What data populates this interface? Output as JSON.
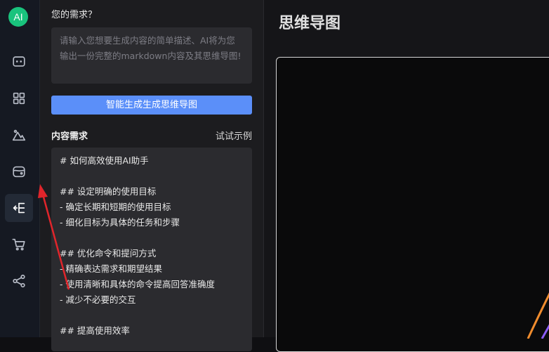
{
  "sidebar": {
    "logo_text": "AI",
    "items": [
      {
        "icon": "chat-icon"
      },
      {
        "icon": "apps-grid-icon"
      },
      {
        "icon": "image-landscape-icon"
      },
      {
        "icon": "wallet-icon"
      },
      {
        "icon": "mindmap-icon",
        "active": true
      },
      {
        "icon": "cart-icon"
      },
      {
        "icon": "share-icon"
      }
    ]
  },
  "panel": {
    "question_label": "您的需求？",
    "prompt_placeholder": "请输入您想要生成内容的简单描述、AI将为您输出一份完整的markdown内容及其思维导图!",
    "generate_button": "智能生成生成思维导图",
    "content_title": "内容需求",
    "example_link": "试试示例",
    "content_lines": [
      "# 如何高效使用AI助手",
      "",
      "## 设定明确的使用目标",
      "- 确定长期和短期的使用目标",
      "- 细化目标为具体的任务和步骤",
      "",
      "## 优化命令和提问方式",
      "- 精确表达需求和期望结果",
      "- 使用清晰和具体的命令提高回答准确度",
      "- 减少不必要的交互",
      "",
      "## 提高使用效率"
    ]
  },
  "main": {
    "title": "思维导图"
  },
  "colors": {
    "accent": "#5b8ff9",
    "logo": "#19c37d",
    "arrow": "#e0252b",
    "curve_orange": "#f08c2e",
    "curve_purple": "#8b5cf6"
  }
}
